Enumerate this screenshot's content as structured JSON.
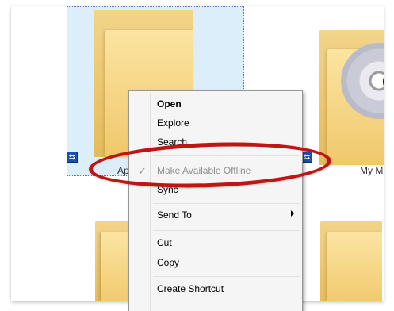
{
  "folders": [
    {
      "label": "Ap"
    },
    {
      "label": "My Mu"
    }
  ],
  "context_menu": {
    "items": [
      {
        "label": "Open",
        "style": "bold"
      },
      {
        "label": "Explore"
      },
      {
        "label": "Search..."
      },
      {
        "label": "Make Available Offline",
        "checked": true,
        "disabled": true
      },
      {
        "label": "Sync"
      },
      {
        "label": "Send To",
        "submenu": true
      },
      {
        "label": "Cut"
      },
      {
        "label": "Copy"
      },
      {
        "label": "Create Shortcut"
      }
    ],
    "check_glyph": "✓"
  },
  "icons": {
    "sync_badge": "sync-icon",
    "submenu": "chevron-right-icon"
  },
  "colors": {
    "highlight_ring": "#c01515",
    "selection_bg": "#dceefa",
    "menu_bg": "#f5f5f5"
  }
}
